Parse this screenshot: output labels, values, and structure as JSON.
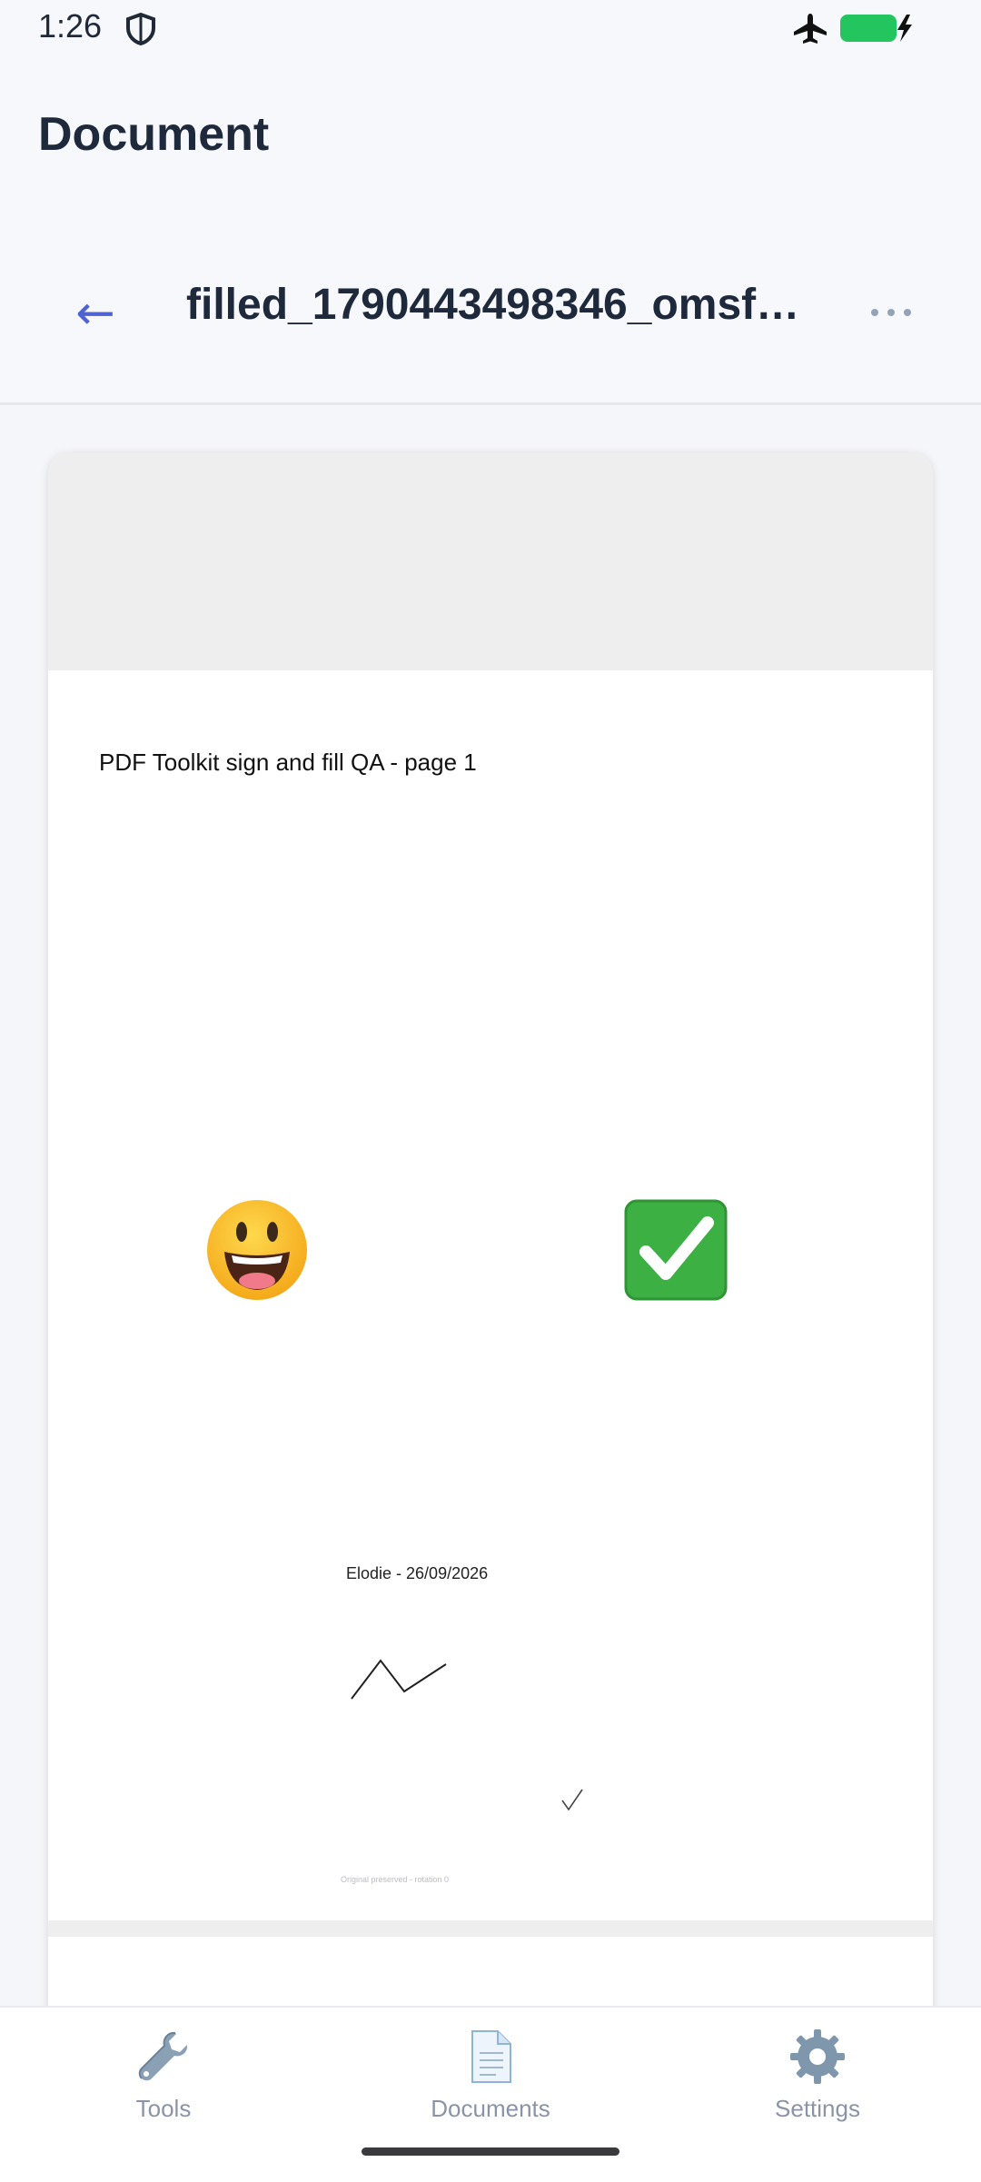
{
  "status_bar": {
    "time": "1:26",
    "icons": [
      "shield-icon",
      "airplane-icon",
      "battery-charging-icon"
    ],
    "battery_color": "#22c55e"
  },
  "header": {
    "title": "Document"
  },
  "toolbar": {
    "back_label": "←",
    "file_name": "filled_1790443498346_omsfy…",
    "more_icon": "more-horizontal-icon"
  },
  "document": {
    "page1": {
      "heading": "PDF Toolkit sign and fill QA - page 1",
      "stamps": [
        "smiley-face-icon",
        "check-box-icon"
      ],
      "signature_text": "Elodie - 26/09/2026",
      "footnote": "Original preserved - rotation 0"
    }
  },
  "bottom_nav": {
    "items": [
      {
        "label": "Tools",
        "icon": "wrench-icon"
      },
      {
        "label": "Documents",
        "icon": "document-icon"
      },
      {
        "label": "Settings",
        "icon": "gear-icon"
      }
    ]
  },
  "colors": {
    "accent": "#4f63d2",
    "nav_inactive": "#8a94a6",
    "background": "#f7f8fb"
  }
}
